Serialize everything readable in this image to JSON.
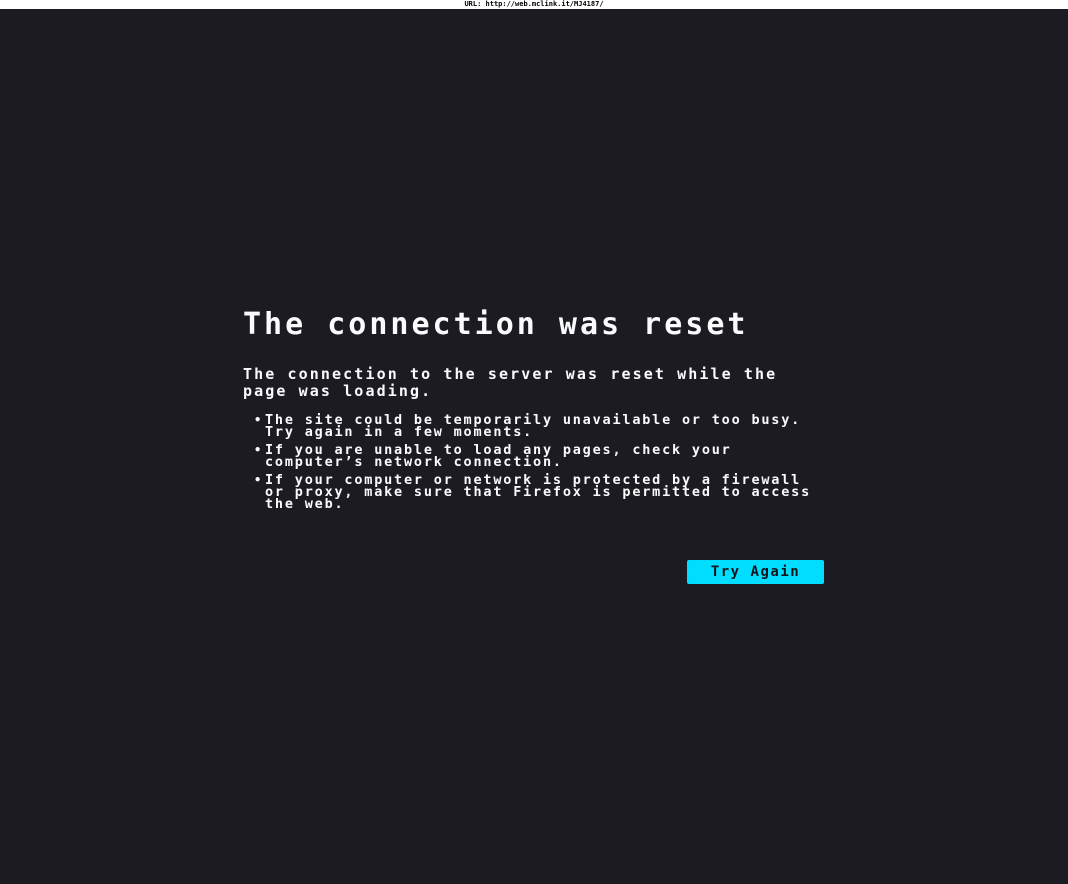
{
  "url_bar": {
    "text": "URL: http://web.mclink.it/MJ4187/"
  },
  "error": {
    "title": "The connection was reset",
    "description": "The connection to the server was reset while the page was loading.",
    "suggestions": [
      "The site could be temporarily unavailable or too busy. Try again in a few moments.",
      "If you are unable to load any pages, check your computer’s network connection.",
      "If your computer or network is protected by a firewall or proxy, make sure that Firefox is permitted to access the web."
    ],
    "button_label": "Try Again"
  },
  "colors": {
    "background": "#1c1b22",
    "text": "#fbfbfe",
    "accent": "#00ddff"
  }
}
